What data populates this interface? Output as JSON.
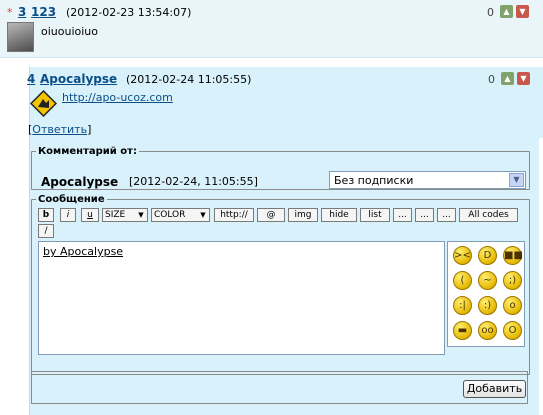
{
  "comment1": {
    "star": "*",
    "number": "3",
    "user": "123",
    "date": "(2012-02-23 13:54:07)",
    "text": "oiuouioiuo",
    "rating": "0"
  },
  "comment2": {
    "number": "4",
    "user": "Apocalypse",
    "date": "(2012-02-24 11:05:55)",
    "url": "http://apo-ucoz.com",
    "reply": "Ответить",
    "rating": "0"
  },
  "form": {
    "comment_legend": "Комментарий от:",
    "author": "Apocalypse",
    "author_date": "[2012-02-24, 11:05:55]",
    "subscription_value": "Без подписки",
    "message_legend": "Сообщение",
    "toolbar": {
      "bold": "b",
      "italic": "i",
      "underline": "u",
      "size": "SIZE",
      "color": "COLOR",
      "url": "http://",
      "email": "@",
      "img": "img",
      "hide": "hide",
      "list": "list",
      "more1": "...",
      "more2": "...",
      "more3": "...",
      "all_codes": "All codes",
      "slash": "/"
    },
    "message_text": "by Apocalypse",
    "submit_label": "Добавить"
  },
  "icons": {
    "thumb_up": "thumb-up-icon",
    "thumb_down": "thumb-down-icon",
    "smileys": [
      "angry",
      "grin",
      "cool",
      "sad",
      "sly",
      "wink",
      "frown",
      "smile",
      "surprised",
      "laugh",
      "blush",
      "shock"
    ]
  }
}
